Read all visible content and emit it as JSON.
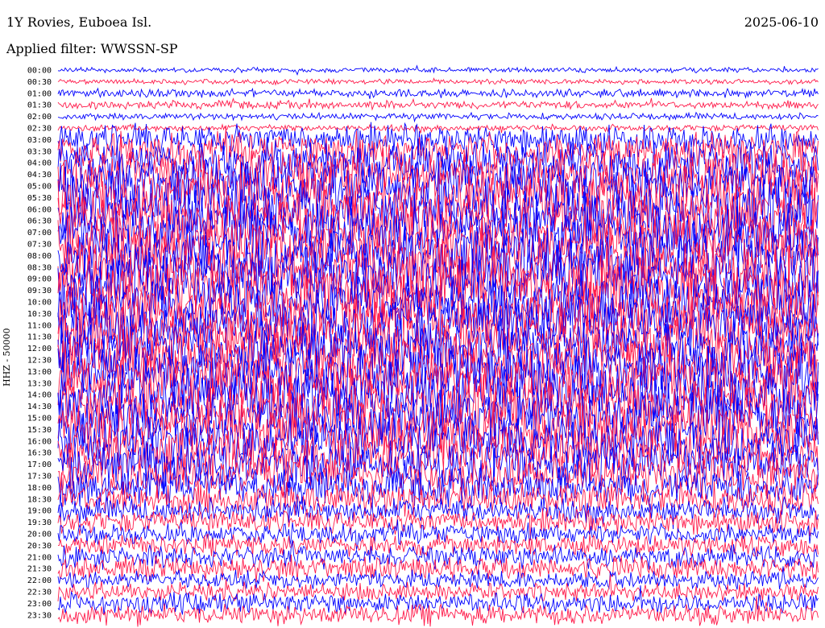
{
  "header": {
    "station": "1Y Rovies, Euboea Isl.",
    "filter": "Applied filter: WWSSN-SP",
    "date": "2025-06-10",
    "channel": "HHZ - 50000"
  },
  "chart_data": {
    "type": "line",
    "title": "1Y Rovies, Euboea Isl.",
    "subtitle": "Applied filter: WWSSN-SP",
    "ylabel": "HHZ - 50000",
    "row_labels": [
      "00:00",
      "00:30",
      "01:00",
      "01:30",
      "02:00",
      "02:30",
      "03:00",
      "03:30",
      "04:00",
      "04:30",
      "05:00",
      "05:30",
      "06:00",
      "06:30",
      "07:00",
      "07:30",
      "08:00",
      "08:30",
      "09:00",
      "09:30",
      "10:00",
      "10:30",
      "11:00",
      "11:30",
      "12:00",
      "12:30",
      "13:00",
      "13:30",
      "14:00",
      "14:30",
      "15:00",
      "15:30",
      "16:00",
      "16:30",
      "17:00",
      "17:30",
      "18:00",
      "18:30",
      "19:00",
      "19:30",
      "20:00",
      "20:30",
      "21:00",
      "21:30",
      "22:00",
      "22:30",
      "23:00",
      "23:30"
    ],
    "series_colors": [
      "#0000ff",
      "#ff1a4a"
    ],
    "grid": false,
    "relative_amplitude_by_row": [
      0.06,
      0.06,
      0.1,
      0.1,
      0.08,
      0.08,
      0.35,
      0.45,
      0.55,
      0.6,
      0.7,
      0.75,
      0.75,
      0.75,
      0.7,
      0.7,
      0.75,
      0.75,
      0.75,
      0.75,
      0.75,
      0.75,
      0.7,
      0.7,
      0.7,
      0.7,
      0.75,
      0.75,
      0.75,
      0.75,
      0.7,
      0.7,
      0.65,
      0.6,
      0.55,
      0.5,
      0.45,
      0.4,
      0.3,
      0.28,
      0.25,
      0.25,
      0.28,
      0.28,
      0.22,
      0.22,
      0.25,
      0.25
    ]
  }
}
